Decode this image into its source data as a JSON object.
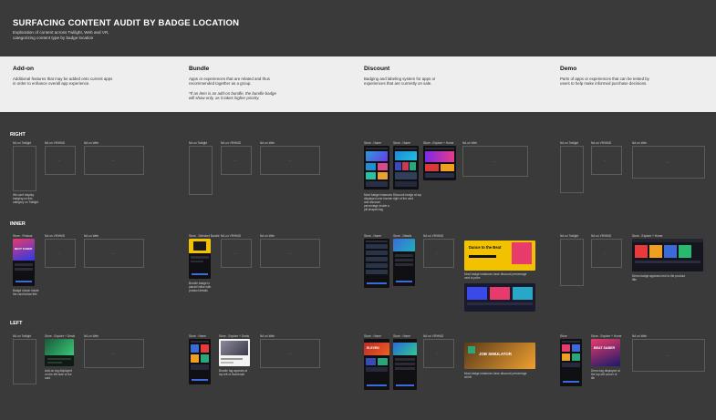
{
  "header": {
    "title": "SURFACING CONTENT AUDIT BY BADGE LOCATION",
    "subtitle": "Exploration of content across Twilight, Web and VR, categorizing content type by badge location"
  },
  "categories": [
    {
      "name": "Add-on",
      "desc": "Additional features that may be added onto current apps in order to enhance overall app experience."
    },
    {
      "name": "Bundle",
      "desc": "Apps or experiences that are related and thus recommended together as a group.",
      "note": "*If an item is an add-on bundle, the bundle badge will show only, as it takes higher priority."
    },
    {
      "name": "Discount",
      "desc": "Badging and labeling system for apps or experiences that are currently on sale."
    },
    {
      "name": "Demo",
      "desc": "Parts of apps or experiences that can be tested by users to help make informed purchase decisions."
    }
  ],
  "rows": [
    "RIGHT",
    "INNER",
    "LEFT"
  ],
  "frame_labels": {
    "twilight": "NA on Twilight",
    "vr": "NA on VR/HMD",
    "web": "NA on Web",
    "store_home": "Store - Home",
    "store_explore": "Store - Explore + Home",
    "store_bundle": "Store - Selected Bundle",
    "store_product": "Store - Product",
    "store_details": "Store - Details",
    "store_explore_deals": "Store - Explore + Deals",
    "store": "Store"
  },
  "notes": {
    "right_addon": "We can't display badging on this category on Twilight",
    "right_bundle": "Bundle badge can be displayed on top right",
    "right_discount": "Most badge instances displayed over banner and discount percentage inside a pill-shaped tag",
    "right_discount_2": "Discount badge at top right of the card",
    "inner_addon": "Badge shown inside the card below title",
    "inner_bundle": "Bundle badge is placed inline with product details",
    "inner_discount": "Most badge instances have discount percentage next to price",
    "inner_demo": "Demo badge appears next to the product title",
    "left_addon": "Add-on tag displayed on the left side of the card",
    "left_bundle": "Bundle tag appears at top left of thumbnail",
    "left_discount": "Most badge instances have discount percentage at left",
    "left_demo": "Demo tag displayed at the top left corner of tile"
  },
  "art_text": {
    "dance": "Dance to the Beat",
    "beatsaber": "BEAT SABER",
    "eleven": "ELEVEN",
    "job": "JOB SIMULATOR"
  },
  "colors": {
    "background": "#3a3a3a",
    "band": "#eeeeee",
    "accent_blue": "#3a6bd8",
    "accent_yellow": "#f2c200",
    "accent_pink": "#e83a6b"
  }
}
